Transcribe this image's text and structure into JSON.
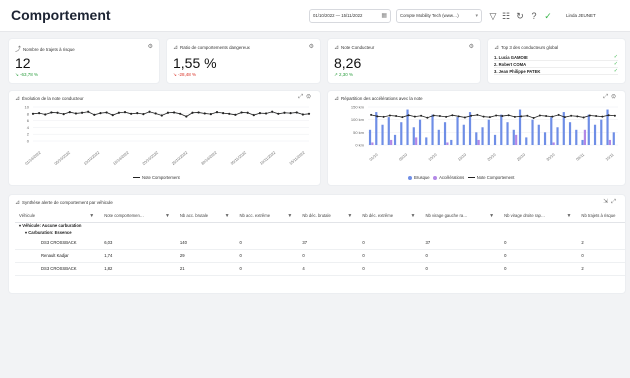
{
  "header": {
    "title": "Comportement",
    "date_range": "01/10/2022 — 15/11/2022",
    "company": "Compte Mobility Tech (www…)",
    "user": "Linda JEUNET"
  },
  "kpis": [
    {
      "title": "Nombre de trajets à risque",
      "value": "12",
      "delta": "-63,78 %",
      "trend": "down-good"
    },
    {
      "title": "Ratio de comportements dangereux",
      "value": "1,55 %",
      "delta": "-28,48 %",
      "trend": "down-bad"
    },
    {
      "title": "Note Conducteur",
      "value": "8,26",
      "delta": "2,30 %",
      "trend": "up-good"
    }
  ],
  "top3": {
    "title": "Top 3 des conducteurs global",
    "drivers": [
      "1. Lucia GAMOIE",
      "2. Robert COMA",
      "3. Jean Philippe PATEK"
    ]
  },
  "chart1": {
    "title": "Évolution de la note conducteur",
    "legend": "Note Comportement"
  },
  "chart2": {
    "title": "Répartition des accélérations avec la note",
    "legend": [
      "Brusque",
      "Accélérations",
      "Note Comportement"
    ]
  },
  "table": {
    "title": "Synthèse alerte de comportement par véhicule",
    "columns": [
      "Véhicule",
      "Note comportemen…",
      "Nb acc. brutale",
      "Nb acc. extrême",
      "Nb déc. brutale",
      "Nb déc. extrême",
      "Nb virage gauche ra…",
      "Nb virage droite rap…",
      "Nb trajets à risque"
    ],
    "group1": "Véhicule: Aucune carburation",
    "group2": "Carburation: Essence",
    "rows": [
      [
        "DS3 CROSSBACK",
        "6,03",
        "140",
        "0",
        "37",
        "0",
        "37",
        "0",
        "2"
      ],
      [
        "Renault Kadjar",
        "1,74",
        "29",
        "0",
        "0",
        "0",
        "0",
        "0",
        "0"
      ],
      [
        "DS3 CROSSBACK",
        "1,82",
        "21",
        "0",
        "4",
        "0",
        "0",
        "0",
        "2"
      ]
    ]
  },
  "chart_data": [
    {
      "type": "line",
      "title": "Évolution de la note conducteur",
      "x": [
        "01/10/2022",
        "05/10/2022",
        "10/10/2022",
        "15/10/2022",
        "20/10/2022",
        "25/10/2022",
        "30/10/2022",
        "05/11/2022",
        "10/11/2022",
        "15/11/2022"
      ],
      "y_ticks": [
        0,
        2,
        4,
        6,
        8,
        10
      ],
      "ylim": [
        0,
        10
      ],
      "series": [
        {
          "name": "Note Comportement",
          "color": "#222222",
          "values": [
            8.0,
            8.2,
            7.8,
            8.4,
            8.3,
            7.9,
            8.5,
            8.1,
            8.3,
            8.6,
            7.7,
            8.2,
            8.4,
            7.6,
            8.3,
            8.5,
            8.0,
            8.2,
            7.9,
            8.6,
            8.1,
            7.5,
            8.3,
            8.4,
            8.0,
            7.2,
            8.3,
            8.4,
            8.1,
            7.9,
            8.5,
            8.2,
            8.0,
            7.7,
            8.4,
            8.3,
            7.6,
            8.2,
            8.1,
            8.6,
            8.0,
            8.3,
            8.2,
            8.4,
            7.8,
            8.0
          ]
        }
      ]
    },
    {
      "type": "bar",
      "title": "Répartition des accélérations avec la note",
      "x": [
        "01/10",
        "05/10",
        "10/10",
        "15/10",
        "20/10",
        "25/10",
        "30/10",
        "05/11",
        "10/11"
      ],
      "y_ticks": [
        "0 km",
        "50 km",
        "100 km",
        "150 km"
      ],
      "series": [
        {
          "name": "Brusque",
          "color": "#6f8ee6",
          "values": [
            60,
            130,
            80,
            110,
            40,
            90,
            140,
            70,
            100,
            30,
            120,
            60,
            90,
            20,
            110,
            80,
            130,
            50,
            70,
            100,
            40,
            120,
            90,
            60,
            140,
            30,
            100,
            80,
            50,
            110,
            70,
            130,
            90,
            60,
            20,
            120,
            80,
            100,
            140,
            50
          ]
        },
        {
          "name": "Accélérations",
          "color": "#b388e6",
          "values": [
            10,
            0,
            0,
            20,
            0,
            0,
            0,
            30,
            0,
            0,
            0,
            0,
            10,
            0,
            0,
            0,
            0,
            20,
            0,
            0,
            0,
            0,
            0,
            40,
            0,
            0,
            0,
            0,
            0,
            10,
            0,
            0,
            0,
            0,
            60,
            0,
            0,
            0,
            20,
            0
          ]
        },
        {
          "name": "Note Comportement",
          "color": "#222222",
          "values": [
            8.6,
            8.1,
            7.9,
            8.4,
            8.2,
            7.8,
            8.5,
            8.0,
            8.3,
            7.6,
            8.4,
            8.2,
            7.9,
            8.5,
            8.1,
            7.7,
            8.3,
            8.6,
            8.0,
            7.8,
            8.4,
            8.2,
            8.5,
            7.9,
            8.1,
            8.3,
            7.5,
            8.4,
            8.2,
            8.0,
            8.6,
            7.8,
            8.3,
            8.1,
            7.7,
            8.4,
            8.2,
            8.0,
            8.5,
            8.3
          ]
        }
      ]
    }
  ]
}
